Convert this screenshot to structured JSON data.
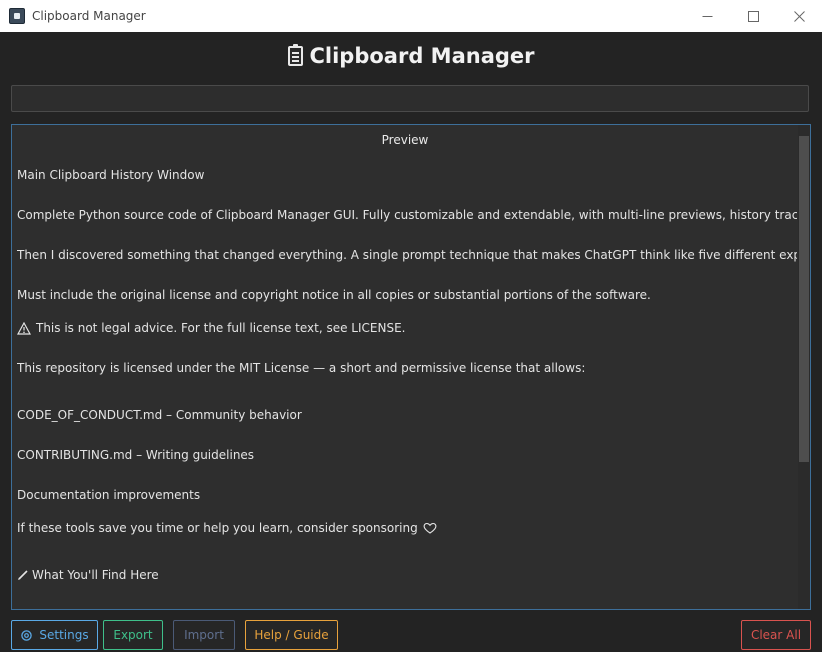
{
  "window": {
    "title": "Clipboard Manager"
  },
  "header": {
    "title": "Clipboard Manager"
  },
  "search": {
    "value": "",
    "placeholder": ""
  },
  "preview": {
    "header": "Preview",
    "lines": [
      "Main Clipboard History Window",
      "Complete Python source code of Clipboard Manager GUI. Fully customizable and extendable, with multi-line previews, history tracking, global hotk",
      "Then I discovered something that changed everything. A single prompt technique that makes ChatGPT think like five different experts arguing in a r",
      "Must include the original license and copyright notice in all copies or substantial portions of the software.",
      "This is not legal advice. For the full license text, see LICENSE.",
      "This repository is licensed under the MIT License — a short and permissive license that allows:",
      "CODE_OF_CONDUCT.md – Community behavior",
      "CONTRIBUTING.md – Writing guidelines",
      "Documentation improvements",
      "If these tools save you time or help you learn, consider sponsoring",
      "What You'll Find Here"
    ]
  },
  "buttons": {
    "settings": "Settings",
    "export": "Export",
    "import": "Import",
    "help": "Help / Guide",
    "clear_all": "Clear All"
  },
  "colors": {
    "settings": "#5aa9e6",
    "export": "#3fbf8a",
    "import": "#5b6b8a",
    "help": "#e8a23c",
    "clear_all": "#d9534f"
  }
}
